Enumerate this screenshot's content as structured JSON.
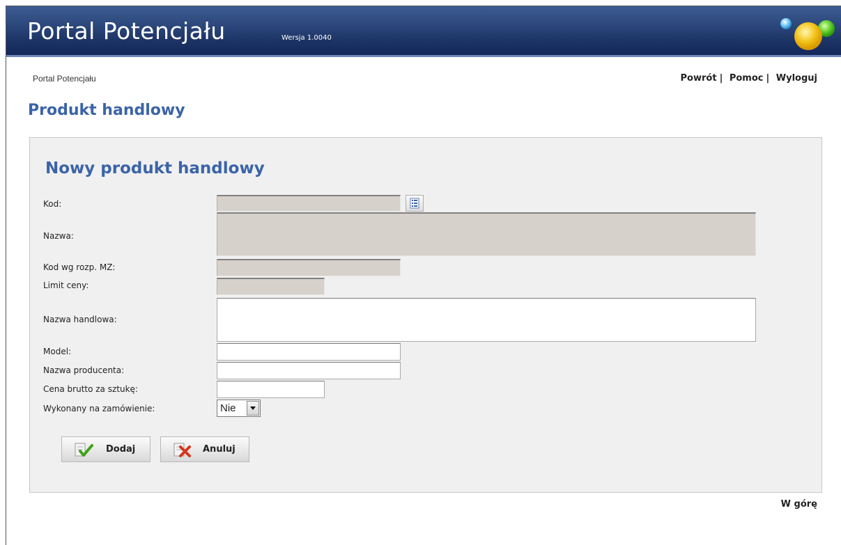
{
  "header": {
    "title": "Portal Potencjału",
    "version": "Wersja 1.0040"
  },
  "breadcrumb": "Portal Potencjału",
  "nav": {
    "back": "Powrót",
    "help": "Pomoc",
    "logout": "Wyloguj",
    "separator": "|"
  },
  "page_title": "Produkt handlowy",
  "form": {
    "title": "Nowy produkt handlowy",
    "labels": {
      "kod": "Kod:",
      "nazwa": "Nazwa:",
      "kod_mz": "Kod wg rozp. MZ:",
      "limit": "Limit ceny:",
      "nazwa_handlowa": "Nazwa handlowa:",
      "model": "Model:",
      "producent": "Nazwa producenta:",
      "cena": "Cena brutto za sztukę:",
      "zamowienie": "Wykonany na zamówienie:"
    },
    "values": {
      "kod": "",
      "nazwa": "",
      "kod_mz": "",
      "limit": "",
      "nazwa_handlowa": "",
      "model": "",
      "producent": "",
      "cena": ""
    },
    "select_value": "Nie",
    "buttons": {
      "add": "Dodaj",
      "cancel": "Anuluj"
    }
  },
  "bottom_link": "W górę",
  "colors": {
    "header_bg": "#1d3466",
    "title_blue": "#3b64a8",
    "readonly_field": "#d6d2cb",
    "panel_bg": "#f0f0f0"
  },
  "icons": [
    "logo-icon",
    "list-picker-icon",
    "check-icon",
    "cancel-x-icon",
    "dropdown-arrow-icon"
  ]
}
